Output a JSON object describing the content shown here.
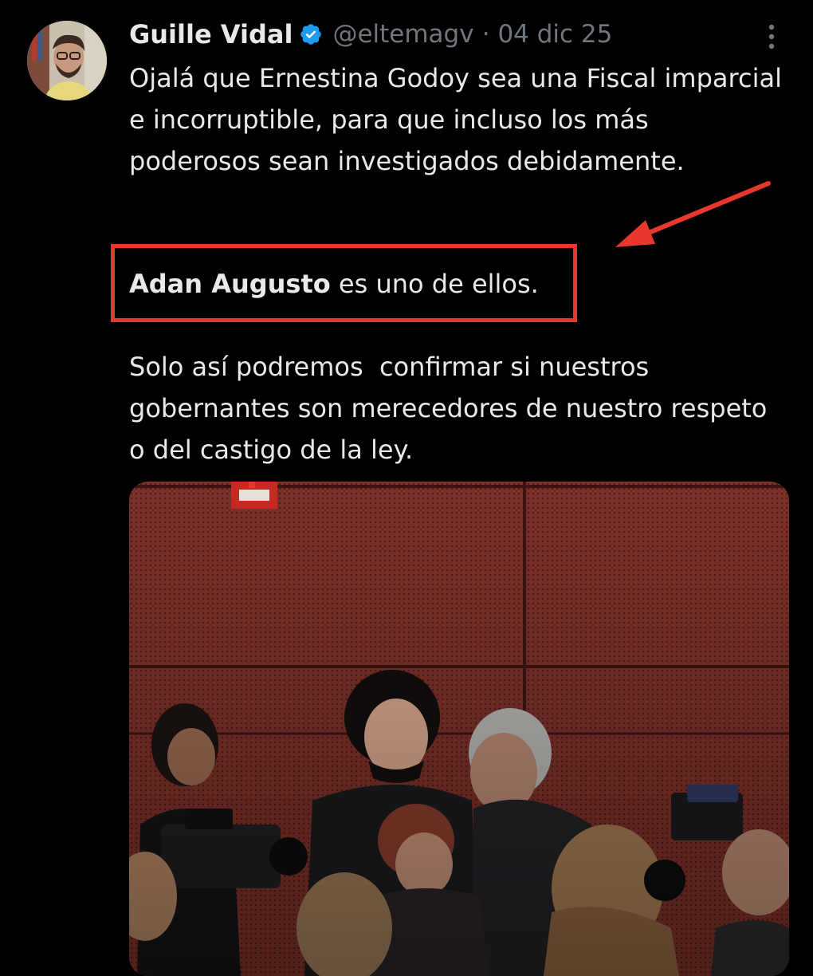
{
  "tweet": {
    "author": {
      "display_name": "Guille Vidal",
      "handle": "@eltemagv",
      "verified_icon": "verified-badge-icon"
    },
    "separator": "·",
    "date": "04 dic 25",
    "more_icon": "more-options-icon",
    "paragraphs": {
      "p1": "Ojalá que Ernestina Godoy sea una Fiscal imparcial e incorruptible, para que incluso los más poderosos sean investigados debidamente.",
      "p2_bold": "Adan Augusto",
      "p2_rest": " es uno de ellos.",
      "p3": "Solo así podremos  confirmar si nuestros gobernantes son merecedores de nuestro respeto o del castigo de la ley."
    },
    "media_icon": "photo"
  },
  "annotations": {
    "highlight_color": "#e8372c"
  },
  "colors": {
    "background": "#000000",
    "text": "#e7e9ea",
    "muted": "#71767b",
    "verified": "#1d9bf0",
    "annotation": "#e8372c"
  }
}
